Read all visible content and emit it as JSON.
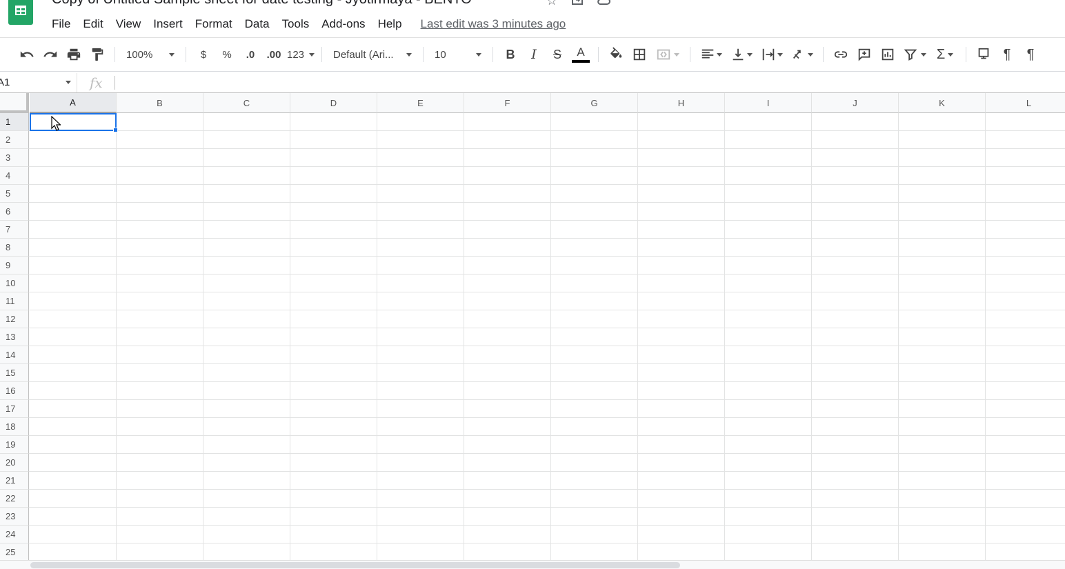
{
  "app": {
    "title": "Copy of Untitled Sample sheet for date testing - Jyotirmaya - BENTO",
    "last_edit": "Last edit was 3 minutes ago",
    "brand_color": "#23a566",
    "accent_color": "#1a73e8"
  },
  "title_icons": [
    "star-icon",
    "move-to-folder-icon",
    "cloud-saved-icon"
  ],
  "menu": [
    "File",
    "Edit",
    "View",
    "Insert",
    "Format",
    "Data",
    "Tools",
    "Add-ons",
    "Help"
  ],
  "toolbar": {
    "zoom": "100%",
    "currency": "$",
    "percent": "%",
    "decrease_decimal": ".0",
    "increase_decimal": ".00",
    "more_formats": "123",
    "font": "Default (Ari...",
    "font_size": "10"
  },
  "formula_bar": {
    "cell_ref": "A1",
    "fx": "fx",
    "value": ""
  },
  "sheet": {
    "columns": [
      "A",
      "B",
      "C",
      "D",
      "E",
      "F",
      "G",
      "H",
      "I",
      "J",
      "K",
      "L"
    ],
    "rows": [
      "1",
      "2",
      "3",
      "4",
      "5",
      "6",
      "7",
      "8",
      "9",
      "10",
      "11",
      "12",
      "13",
      "14",
      "15",
      "16",
      "17",
      "18",
      "19",
      "20",
      "21",
      "22",
      "23",
      "24",
      "25"
    ],
    "selected_cell": "A1"
  }
}
